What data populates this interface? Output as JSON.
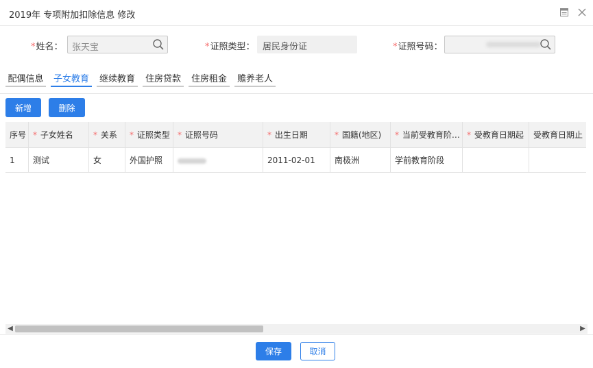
{
  "window": {
    "title": "2019年 专项附加扣除信息 修改"
  },
  "form": {
    "name_label": "姓名：",
    "name_value": "张天宝",
    "cert_type_label": "证照类型：",
    "cert_type_value": "居民身份证",
    "cert_no_label": "证照号码："
  },
  "tabs": [
    "配偶信息",
    "子女教育",
    "继续教育",
    "住房贷款",
    "住房租金",
    "赡养老人"
  ],
  "active_tab": "子女教育",
  "toolbar": {
    "add_label": "新增",
    "delete_label": "删除"
  },
  "table": {
    "headers": [
      "序号",
      "子女姓名",
      "关系",
      "证照类型",
      "证照号码",
      "出生日期",
      "国籍(地区)",
      "当前受教育阶…",
      "受教育日期起",
      "受教育日期止"
    ],
    "rows": [
      [
        "1",
        "测试",
        "女",
        "外国护照",
        "",
        "2011-02-01",
        "南极洲",
        "学前教育阶段",
        "",
        ""
      ]
    ]
  },
  "footer": {
    "save_label": "保存",
    "cancel_label": "取消"
  },
  "colors": {
    "accent": "#2d7ee8",
    "required": "#f56c6c"
  },
  "icons": {
    "maximize": "maximize-icon",
    "close": "close-icon",
    "search": "search-icon"
  }
}
